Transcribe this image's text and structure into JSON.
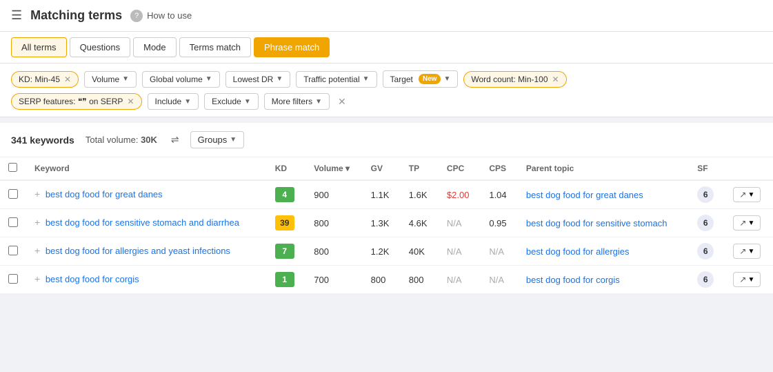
{
  "header": {
    "title": "Matching terms",
    "help_tooltip": "?",
    "how_to_use": "How to use"
  },
  "tabs": [
    {
      "id": "all",
      "label": "All terms",
      "active": true,
      "style": "tab-all"
    },
    {
      "id": "questions",
      "label": "Questions",
      "active": false,
      "style": "tab-questions"
    },
    {
      "id": "mode",
      "label": "Mode",
      "active": false,
      "style": "tab-mode"
    },
    {
      "id": "terms",
      "label": "Terms match",
      "active": false,
      "style": "tab-terms"
    },
    {
      "id": "phrase",
      "label": "Phrase match",
      "active": false,
      "style": "tab-phrase"
    }
  ],
  "filters": {
    "row1": [
      {
        "id": "kd",
        "label": "KD: Min-45",
        "removable": true
      },
      {
        "id": "volume",
        "label": "Volume",
        "dropdown": true
      },
      {
        "id": "global_volume",
        "label": "Global volume",
        "dropdown": true
      },
      {
        "id": "lowest_dr",
        "label": "Lowest DR",
        "dropdown": true
      },
      {
        "id": "traffic_potential",
        "label": "Traffic potential",
        "dropdown": true
      },
      {
        "id": "target",
        "label": "Target",
        "new_badge": true,
        "dropdown": true
      },
      {
        "id": "word_count",
        "label": "Word count: Min-100",
        "removable": true
      }
    ],
    "row2": [
      {
        "id": "serp",
        "label": "SERP features: ❝❞ on SERP",
        "removable": true
      },
      {
        "id": "include",
        "label": "Include",
        "dropdown": true
      },
      {
        "id": "exclude",
        "label": "Exclude",
        "dropdown": true
      },
      {
        "id": "more_filters",
        "label": "More filters",
        "dropdown": true
      }
    ],
    "new_label": "New"
  },
  "summary": {
    "keywords_count": "341 keywords",
    "total_volume_label": "Total volume:",
    "total_volume_value": "30K",
    "groups_label": "Groups"
  },
  "table": {
    "columns": [
      {
        "id": "checkbox",
        "label": ""
      },
      {
        "id": "keyword",
        "label": "Keyword"
      },
      {
        "id": "kd",
        "label": "KD"
      },
      {
        "id": "volume",
        "label": "Volume ▾"
      },
      {
        "id": "gv",
        "label": "GV"
      },
      {
        "id": "tp",
        "label": "TP"
      },
      {
        "id": "cpc",
        "label": "CPC"
      },
      {
        "id": "cps",
        "label": "CPS"
      },
      {
        "id": "parent_topic",
        "label": "Parent topic"
      },
      {
        "id": "sf",
        "label": "SF"
      },
      {
        "id": "actions",
        "label": ""
      }
    ],
    "rows": [
      {
        "keyword": "best dog food for great danes",
        "kd_value": "4",
        "kd_color": "green",
        "volume": "900",
        "gv": "1.1K",
        "tp": "1.6K",
        "cpc": "$2.00",
        "cps": "1.04",
        "parent_topic": "best dog food for great danes",
        "sf": "6"
      },
      {
        "keyword": "best dog food for sensitive stomach and diarrhea",
        "kd_value": "39",
        "kd_color": "yellow",
        "volume": "800",
        "gv": "1.3K",
        "tp": "4.6K",
        "cpc": "N/A",
        "cps": "0.95",
        "parent_topic": "best dog food for sensitive stomach",
        "sf": "6"
      },
      {
        "keyword": "best dog food for allergies and yeast infections",
        "kd_value": "7",
        "kd_color": "green",
        "volume": "800",
        "gv": "1.2K",
        "tp": "40K",
        "cpc": "N/A",
        "cps": "N/A",
        "parent_topic": "best dog food for allergies",
        "sf": "6"
      },
      {
        "keyword": "best dog food for corgis",
        "kd_value": "1",
        "kd_color": "green",
        "volume": "700",
        "gv": "800",
        "tp": "800",
        "cpc": "N/A",
        "cps": "N/A",
        "parent_topic": "best dog food for corgis",
        "sf": "6"
      }
    ]
  }
}
